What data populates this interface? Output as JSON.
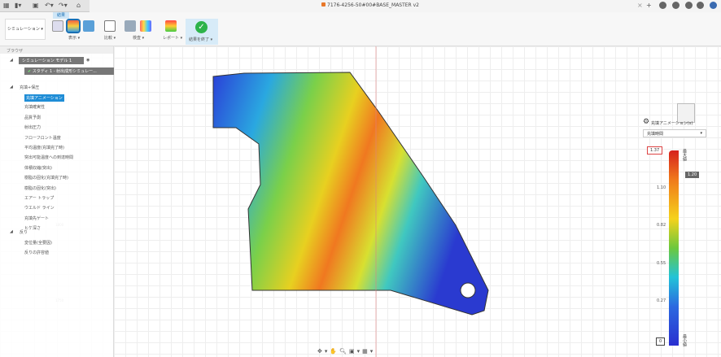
{
  "title_bar": {
    "document_title": "7176-4256-50#00#BASE_MASTER v2"
  },
  "toolbar": {
    "workspace": "シミュレーション ▾",
    "tab_result": "結果",
    "groups": [
      "表示 ▾",
      "比較 ▾",
      "検査 ▾",
      "レポート ▾",
      "結果を終了 ▾"
    ]
  },
  "browser": {
    "header": "ブラウザ",
    "model": "シミュレーション モデル 1",
    "study": "スタディ 1 - 射出成形シミュレー...",
    "section_fill": "充填+保圧",
    "fill_items": [
      "充填アニメーション",
      "充填確実性",
      "品質予測",
      "射出圧力",
      "フローフロント温度",
      "平均温度(充填完了時)",
      "突出可能温度への到達時間",
      "体積収縮(突出)",
      "樹脂の固化(充填完了時)",
      "樹脂の固化(突出)",
      "エアー トラップ",
      "ウエルド ライン",
      "充填先ゲート",
      "ヒケ深さ"
    ],
    "section_warp": "反り",
    "warp_items": [
      "変位量(全要因)",
      "反りの許容値"
    ]
  },
  "axis": {
    "labels": [
      "1800",
      "1800",
      "1750"
    ]
  },
  "legend": {
    "title": "充填アニメーション(s)",
    "select": "充填時間",
    "max": "1.37",
    "current": "1.20",
    "min": "0",
    "ticks": [
      "1.10",
      "0.82",
      "0.55",
      "0.27"
    ],
    "max_label": "最大値",
    "min_label": "最小値",
    "current_fraction": 0.876
  }
}
